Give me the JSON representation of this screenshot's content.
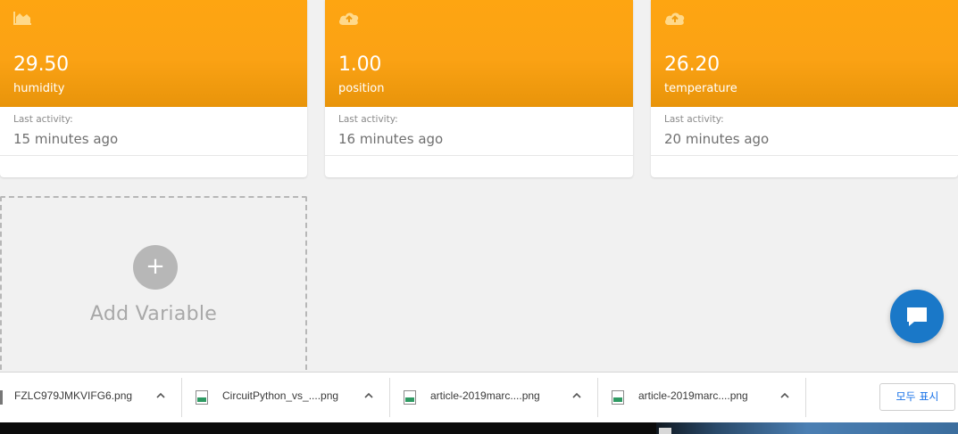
{
  "cards": [
    {
      "icon": "area-chart-icon",
      "value": "29.50",
      "name": "humidity",
      "activity_label": "Last activity:",
      "activity_value": "15 minutes ago"
    },
    {
      "icon": "cloud-upload-icon",
      "value": "1.00",
      "name": "position",
      "activity_label": "Last activity:",
      "activity_value": "16 minutes ago"
    },
    {
      "icon": "cloud-upload-icon",
      "value": "26.20",
      "name": "temperature",
      "activity_label": "Last activity:",
      "activity_value": "20 minutes ago"
    }
  ],
  "add_variable": {
    "label": "Add Variable",
    "plus": "+"
  },
  "chat": {
    "icon": "chat-bubble-icon"
  },
  "downloads": {
    "items": [
      {
        "name": "FZLC979JMKVIFG6.png"
      },
      {
        "name": "CircuitPython_vs_....png"
      },
      {
        "name": "article-2019marc....png"
      },
      {
        "name": "article-2019marc....png"
      }
    ],
    "show_all": "모두 표시"
  },
  "colors": {
    "card_accent": "#fea511",
    "chat_button": "#1a78c8",
    "link": "#1a73e8"
  }
}
